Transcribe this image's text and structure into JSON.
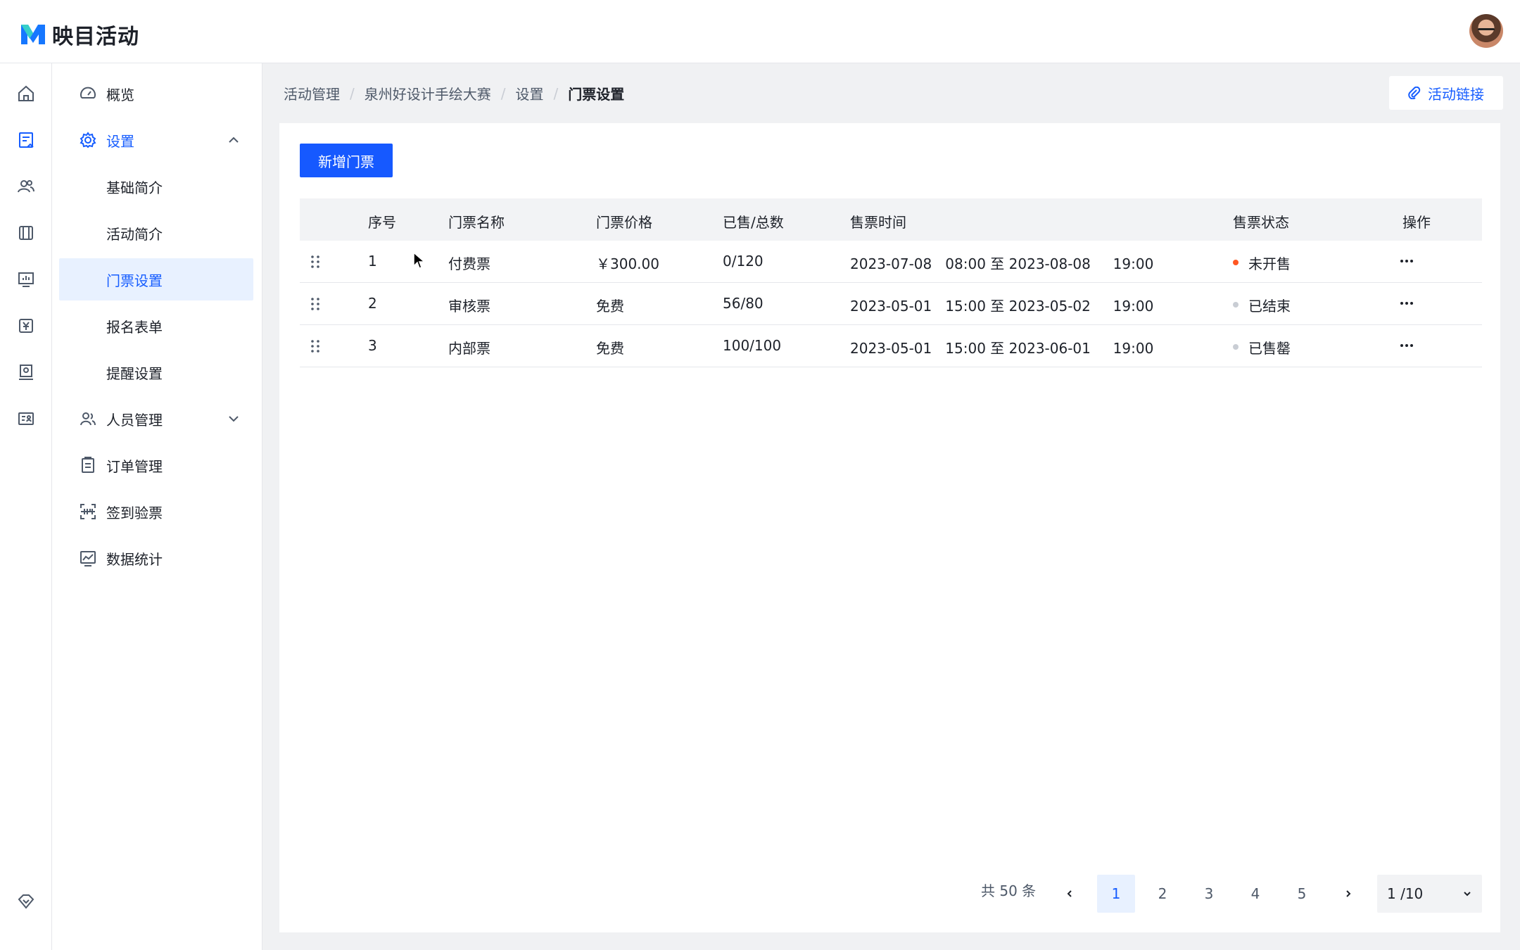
{
  "app": {
    "title": "映目活动"
  },
  "breadcrumb": [
    "活动管理",
    "泉州好设计手绘大赛",
    "设置",
    "门票设置"
  ],
  "actions": {
    "activity_link": "活动链接",
    "add_ticket": "新增门票"
  },
  "sidebar": {
    "items": [
      {
        "label": "概览"
      },
      {
        "label": "设置"
      },
      {
        "label": "基础简介"
      },
      {
        "label": "活动简介"
      },
      {
        "label": "门票设置"
      },
      {
        "label": "报名表单"
      },
      {
        "label": "提醒设置"
      },
      {
        "label": "人员管理"
      },
      {
        "label": "订单管理"
      },
      {
        "label": "签到验票"
      },
      {
        "label": "数据统计"
      }
    ]
  },
  "table": {
    "columns": [
      "序号",
      "门票名称",
      "门票价格",
      "已售/总数",
      "售票时间",
      "售票状态",
      "操作"
    ],
    "rows": [
      {
        "index": "1",
        "name": "付费票",
        "price": "￥300.00",
        "sold": "0/120",
        "time": "2023-07-08   08:00 至 2023-08-08     19:00",
        "status": "未开售",
        "status_color": "#ff5722"
      },
      {
        "index": "2",
        "name": "审核票",
        "price": "免费",
        "sold": "56/80",
        "time": "2023-05-01   15:00 至 2023-05-02     19:00",
        "status": "已结束",
        "status_color": "#c9cdd4"
      },
      {
        "index": "3",
        "name": "内部票",
        "price": "免费",
        "sold": "100/100",
        "time": "2023-05-01   15:00 至 2023-06-01     19:00",
        "status": "已售罄",
        "status_color": "#c9cdd4"
      }
    ]
  },
  "pagination": {
    "total_text": "共 50 条",
    "pages": [
      "1",
      "2",
      "3",
      "4",
      "5"
    ],
    "current": "1",
    "page_size_text": "1 /10"
  },
  "colors": {
    "primary": "#165dff",
    "active_bg": "#e8f1ff"
  }
}
